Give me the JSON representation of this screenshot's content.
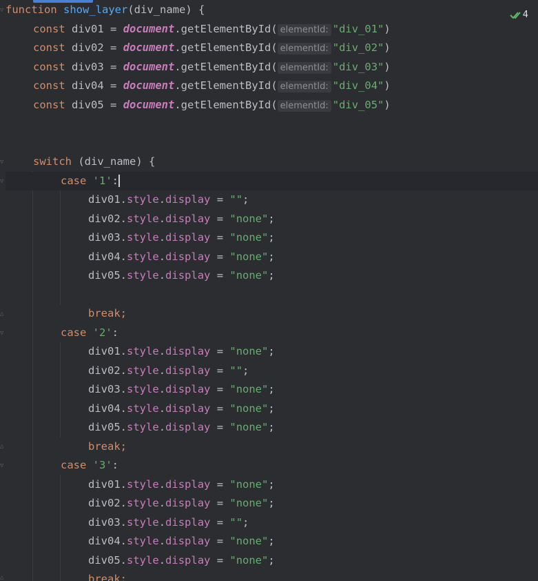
{
  "status": {
    "inspection_count": "4"
  },
  "code": {
    "line0": {
      "kw": "function",
      "name": "show_layer",
      "rest": "(div_name) {"
    },
    "decls": [
      {
        "kw": "const",
        "var": "div01",
        "eq": " = ",
        "doc": "document",
        "method": ".getElementById(",
        "hint": "elementId:",
        "arg": "\"div_01\"",
        "close": ")"
      },
      {
        "kw": "const",
        "var": "div02",
        "eq": " = ",
        "doc": "document",
        "method": ".getElementById(",
        "hint": "elementId:",
        "arg": "\"div_02\"",
        "close": ")"
      },
      {
        "kw": "const",
        "var": "div03",
        "eq": " = ",
        "doc": "document",
        "method": ".getElementById(",
        "hint": "elementId:",
        "arg": "\"div_03\"",
        "close": ")"
      },
      {
        "kw": "const",
        "var": "div04",
        "eq": " = ",
        "doc": "document",
        "method": ".getElementById(",
        "hint": "elementId:",
        "arg": "\"div_04\"",
        "close": ")"
      },
      {
        "kw": "const",
        "var": "div05",
        "eq": " = ",
        "doc": "document",
        "method": ".getElementById(",
        "hint": "elementId:",
        "arg": "\"div_05\"",
        "close": ")"
      }
    ],
    "switch_kw": "switch",
    "switch_rest": " (div_name) {",
    "case_kw": "case",
    "break_kw": "break;",
    "style_tok": "style",
    "display_tok": "display",
    "cases": [
      {
        "label": "'1'",
        "assign": [
          {
            "var": "div01",
            "val": "\"\""
          },
          {
            "var": "div02",
            "val": "\"none\""
          },
          {
            "var": "div03",
            "val": "\"none\""
          },
          {
            "var": "div04",
            "val": "\"none\""
          },
          {
            "var": "div05",
            "val": "\"none\""
          }
        ]
      },
      {
        "label": "'2'",
        "assign": [
          {
            "var": "div01",
            "val": "\"none\""
          },
          {
            "var": "div02",
            "val": "\"\""
          },
          {
            "var": "div03",
            "val": "\"none\""
          },
          {
            "var": "div04",
            "val": "\"none\""
          },
          {
            "var": "div05",
            "val": "\"none\""
          }
        ]
      },
      {
        "label": "'3'",
        "assign": [
          {
            "var": "div01",
            "val": "\"none\""
          },
          {
            "var": "div02",
            "val": "\"none\""
          },
          {
            "var": "div03",
            "val": "\"\""
          },
          {
            "var": "div04",
            "val": "\"none\""
          },
          {
            "var": "div05",
            "val": "\"none\""
          }
        ]
      }
    ]
  }
}
